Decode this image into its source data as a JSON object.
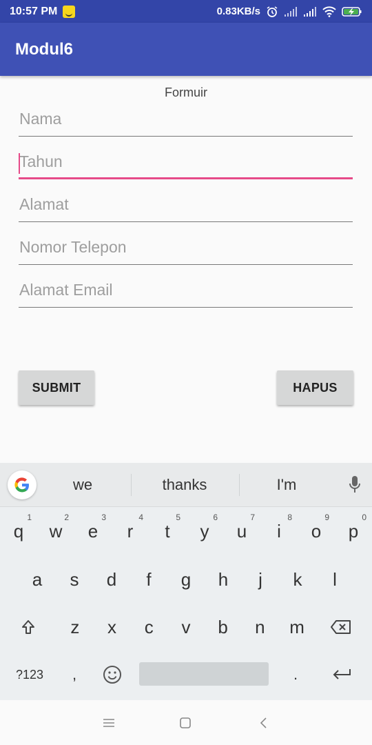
{
  "status_bar": {
    "time": "10:57 PM",
    "net_speed": "0.83KB/s"
  },
  "app_bar": {
    "title": "Modul6"
  },
  "form": {
    "title": "Formuir",
    "fields": [
      {
        "placeholder": "Nama",
        "value": ""
      },
      {
        "placeholder": "Tahun",
        "value": ""
      },
      {
        "placeholder": "Alamat",
        "value": ""
      },
      {
        "placeholder": "Nomor Telepon",
        "value": ""
      },
      {
        "placeholder": "Alamat Email",
        "value": ""
      }
    ],
    "submit_label": "SUBMIT",
    "hapus_label": "HAPUS"
  },
  "keyboard": {
    "suggestions": [
      "we",
      "thanks",
      "I'm"
    ],
    "row1": [
      {
        "key": "q",
        "hint": "1"
      },
      {
        "key": "w",
        "hint": "2"
      },
      {
        "key": "e",
        "hint": "3"
      },
      {
        "key": "r",
        "hint": "4"
      },
      {
        "key": "t",
        "hint": "5"
      },
      {
        "key": "y",
        "hint": "6"
      },
      {
        "key": "u",
        "hint": "7"
      },
      {
        "key": "i",
        "hint": "8"
      },
      {
        "key": "o",
        "hint": "9"
      },
      {
        "key": "p",
        "hint": "0"
      }
    ],
    "row2": [
      "a",
      "s",
      "d",
      "f",
      "g",
      "h",
      "j",
      "k",
      "l"
    ],
    "row3": [
      "z",
      "x",
      "c",
      "v",
      "b",
      "n",
      "m"
    ],
    "symbols_label": "?123",
    "comma": ",",
    "period": "."
  },
  "colors": {
    "status_bar": "#3345a8",
    "app_bar": "#3f51b5",
    "accent": "#e64a88"
  }
}
